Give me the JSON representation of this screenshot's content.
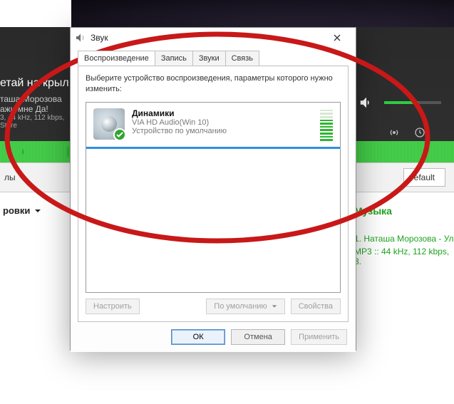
{
  "player": {
    "title_fragment": "етай на крыл",
    "artist_fragment": "таша Морозова",
    "line2": "ажи мне Да!",
    "meta_fragment": "3, 44 kHz, 112 kbps, Stere"
  },
  "bottom_bar": {
    "left_label": "лы",
    "right_button": "efault"
  },
  "left_partial": {
    "rovki": "ровки"
  },
  "right_pane": {
    "header": "Музыка",
    "track_line1": "1. Наташа Морозова - Ул",
    "track_line2": "MP3 :: 44 kHz, 112 kbps, 3."
  },
  "dialog": {
    "title": "Звук",
    "tabs": {
      "playback": "Воспроизведение",
      "record": "Запись",
      "sounds": "Звуки",
      "comm": "Связь"
    },
    "instruction": "Выберите устройство воспроизведения, параметры которого нужно изменить:",
    "device": {
      "name": "Динамики",
      "driver": "VIA HD Audio(Win 10)",
      "status": "Устройство по умолчанию"
    },
    "buttons": {
      "configure": "Настроить",
      "set_default": "По умолчанию",
      "properties": "Свойства",
      "ok": "ОК",
      "cancel": "Отмена",
      "apply": "Применить"
    }
  }
}
